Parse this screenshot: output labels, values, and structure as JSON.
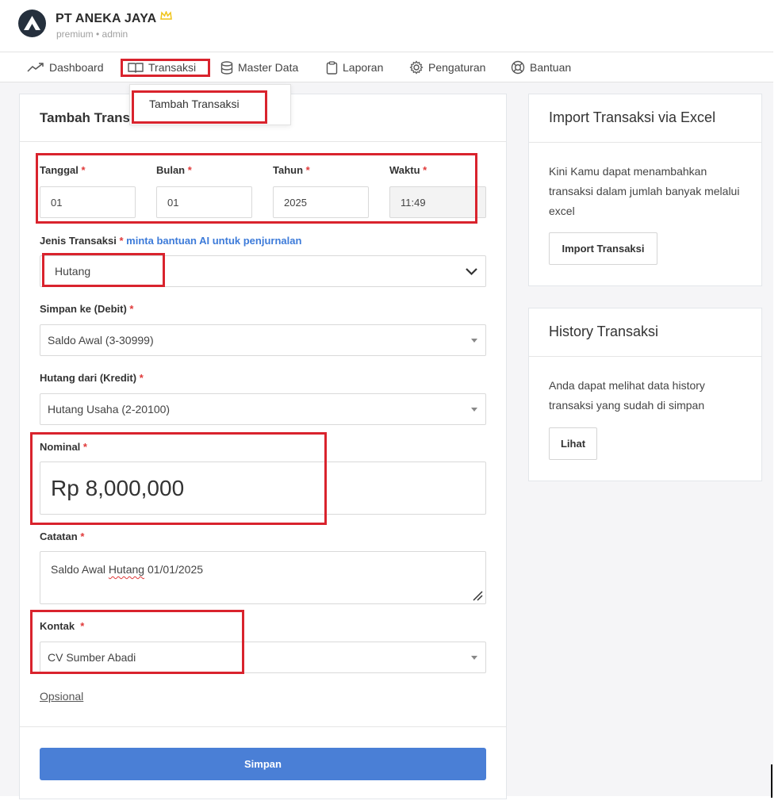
{
  "header": {
    "company_name": "PT ANEKA JAYA",
    "company_sub": "premium • admin"
  },
  "nav": {
    "dashboard": "Dashboard",
    "transaksi": "Transaksi",
    "master_data": "Master Data",
    "laporan": "Laporan",
    "pengaturan": "Pengaturan",
    "bantuan": "Bantuan"
  },
  "dropdown": {
    "tambah_transaksi": "Tambah Transaksi"
  },
  "form": {
    "title": "Tambah Transaksi",
    "tanggal_label": "Tanggal",
    "bulan_label": "Bulan",
    "tahun_label": "Tahun",
    "waktu_label": "Waktu",
    "tanggal_value": "01",
    "bulan_value": "01",
    "tahun_value": "2025",
    "waktu_value": "11:49",
    "jenis_label": "Jenis Transaksi",
    "ai_link": "minta bantuan AI untuk penjurnalan",
    "jenis_value": "Hutang",
    "simpan_ke_label": "Simpan ke (Debit)",
    "simpan_ke_value": "Saldo Awal (3-30999)",
    "hutang_dari_label": "Hutang dari (Kredit)",
    "hutang_dari_value": "Hutang Usaha (2-20100)",
    "nominal_label": "Nominal",
    "nominal_value": "Rp 8,000,000",
    "catatan_label": "Catatan",
    "catatan_prefix": "Saldo Awal ",
    "catatan_word": "Hutang",
    "catatan_suffix": " 01/01/2025",
    "kontak_label": "Kontak",
    "kontak_value": "CV Sumber Abadi",
    "opsional_link": "Opsional",
    "required_mark": "*",
    "submit_label": "Simpan"
  },
  "import_card": {
    "title": "Import Transaksi via Excel",
    "description": "Kini Kamu dapat menambahkan transaksi dalam jumlah banyak melalui excel",
    "button_label": "Import Transaksi"
  },
  "history_card": {
    "title": "History Transaksi",
    "description": "Anda dapat melihat data history transaksi yang sudah di simpan",
    "button_label": "Lihat"
  },
  "colors": {
    "primary": "#4a7fd6",
    "annotation_red": "#d9232d",
    "required": "#e03a3a",
    "link": "#3d7bd9",
    "crown": "#f0c419"
  },
  "icons": [
    "logo-icon",
    "crown-icon",
    "chart-line-icon",
    "book-icon",
    "database-icon",
    "clipboard-icon",
    "gear-icon",
    "lifebuoy-icon",
    "chevron-down-icon",
    "caret-down-icon",
    "resize-handle-icon"
  ]
}
